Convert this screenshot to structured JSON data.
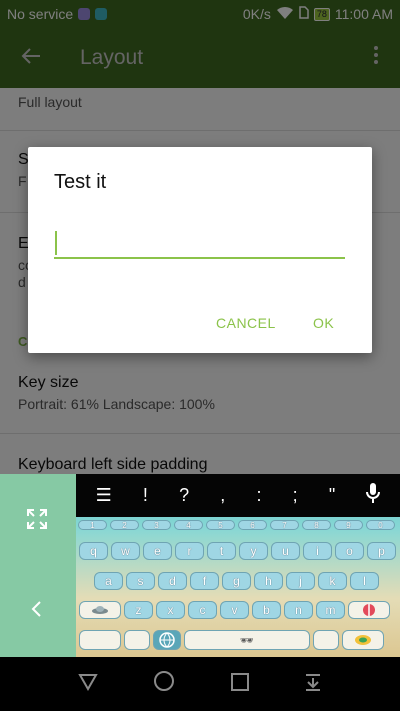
{
  "status_bar": {
    "carrier": "No service",
    "speed": "0K/s",
    "battery": "78",
    "time": "11:00 AM"
  },
  "app_bar": {
    "title": "Layout",
    "back_icon": "arrow-left-icon",
    "menu_icon": "more-vert-icon"
  },
  "settings": {
    "items": [
      {
        "title": "",
        "subtitle": "Full layout"
      },
      {
        "title": "S",
        "subtitle": "F"
      },
      {
        "title": "E",
        "subtitle": "co",
        "subtitle2": "d"
      }
    ],
    "section_label": "C",
    "key_size": {
      "title": "Key size",
      "subtitle": "Portrait: 61% Landscape: 100%"
    },
    "padding": {
      "title": "Keyboard left side padding"
    }
  },
  "dialog": {
    "title": "Test it",
    "input_value": "",
    "cancel_label": "CANCEL",
    "ok_label": "OK"
  },
  "keyboard": {
    "top_row": [
      "☰",
      "!",
      "?",
      ",",
      ":",
      ";",
      "\""
    ],
    "numbers": [
      "1",
      "2",
      "3",
      "4",
      "5",
      "6",
      "7",
      "8",
      "9",
      "0"
    ],
    "row1": [
      "q",
      "w",
      "e",
      "r",
      "t",
      "y",
      "u",
      "i",
      "o",
      "p"
    ],
    "row2": [
      "a",
      "s",
      "d",
      "f",
      "g",
      "h",
      "j",
      "k",
      "l"
    ],
    "row3": [
      "z",
      "x",
      "c",
      "v",
      "b",
      "n",
      "m"
    ],
    "space_label": "🕶"
  },
  "colors": {
    "accent": "#8bc34a",
    "app_bar": "#3f6a20",
    "side_panel": "#86c9a4"
  }
}
